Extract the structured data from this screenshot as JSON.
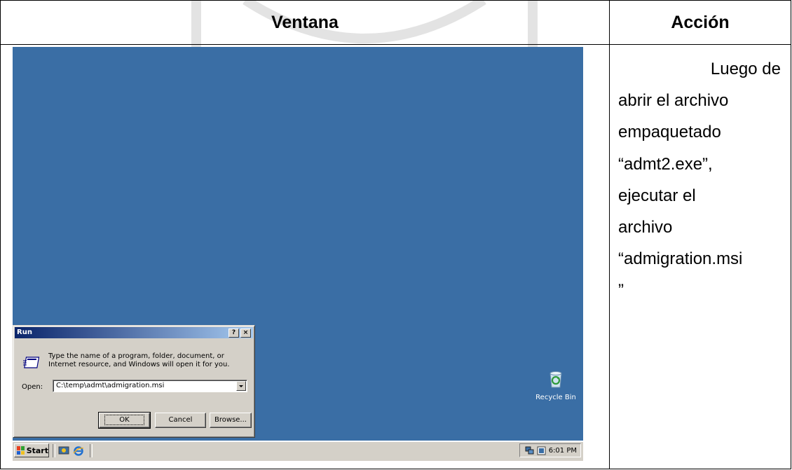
{
  "table": {
    "header_window": "Ventana",
    "header_action": "Acción",
    "action_lines": [
      "Luego de",
      "abrir el archivo",
      "empaquetado",
      "“admt2.exe”,",
      "ejecutar el",
      "archivo",
      "“admigration.msi",
      "”"
    ]
  },
  "screenshot": {
    "run_dialog": {
      "title": "Run",
      "help_btn": "?",
      "close_btn": "×",
      "description_line1": "Type the name of a program, folder, document, or",
      "description_line2": "Internet resource, and Windows will open it for you.",
      "open_label": "Open:",
      "open_value": "C:\\temp\\admt\\admigration.msi",
      "ok_label": "OK",
      "cancel_label": "Cancel",
      "browse_label": "Browse..."
    },
    "recycle_bin_label": "Recycle Bin",
    "start_label": "Start",
    "clock": "6:01 PM",
    "colors": {
      "desktop": "#3a6ea5",
      "title_bar": "#0a246a",
      "chrome": "#d4d0c8"
    }
  }
}
